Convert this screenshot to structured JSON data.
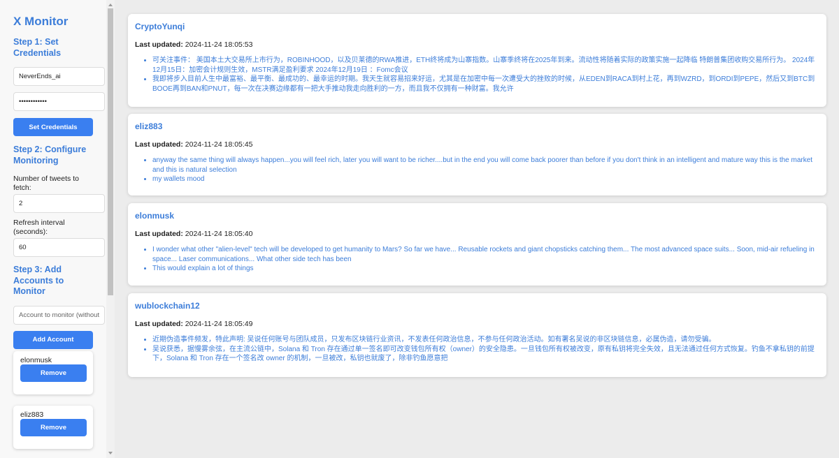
{
  "sidebar": {
    "app_title": "X Monitor",
    "step1_title": "Step 1: Set Credentials",
    "username_value": "NeverEnds_ai",
    "password_value": "••••••••••••",
    "set_credentials_label": "Set Credentials",
    "step2_title": "Step 2: Configure Monitoring",
    "tweets_label": "Number of tweets to fetch:",
    "tweets_value": "2",
    "interval_label": "Refresh interval (seconds):",
    "interval_value": "60",
    "step3_title": "Step 3: Add Accounts to Monitor",
    "account_placeholder": "Account to monitor (without @)",
    "add_account_label": "Add Account",
    "accounts": [
      {
        "name": "elonmusk",
        "remove_label": "Remove"
      },
      {
        "name": "eliz883",
        "remove_label": "Remove"
      }
    ]
  },
  "feed": [
    {
      "username": "CryptoYunqi",
      "updated_label": "Last updated:",
      "updated_time": "2024-11-24 18:05:53",
      "tweets": [
        "可关注事件： 美国本土大交易所上市行为，ROBINHOOD，以及贝莱德的RWA推进，ETH终将成为山寨指数。山寨季终将在2025年到来。流动性将随着实际的政策实施一起降临 特朗普集团收购交易所行为。 2024年12月15日：加密会计规则生效，MSTR满足盈利要求 2024年12月19日 ：Fomc会议",
        "我即将步入目前人生中最富裕、最平衡、最成功的、最幸运的时期。我天生就容易招来好运，尤其是在加密中每一次遭受大的挫败的时候，从EDEN到RACA到村上花，再到WZRD，到ORDI到PEPE，然后又到BTC到BOOE再到BAN和PNUT，每一次在决赛边缘都有一把大手推动我走向胜利的一方，而且我不仅拥有一种财富。我允许"
      ]
    },
    {
      "username": "eliz883",
      "updated_label": "Last updated:",
      "updated_time": "2024-11-24 18:05:45",
      "tweets": [
        "anyway the same thing will always happen...you will feel rich, later you will want to be richer....but in the end you will come back poorer than before if you don't think in an intelligent and mature way this is the market and this is natural selection",
        "my wallets mood"
      ]
    },
    {
      "username": "elonmusk",
      "updated_label": "Last updated:",
      "updated_time": "2024-11-24 18:05:40",
      "tweets": [
        "I wonder what other \"alien-level\" tech will be developed to get humanity to Mars? So far we have... Reusable rockets and giant chopsticks catching them... The most advanced space suits... Soon, mid-air refueling in space... Laser communications... What other side tech has been",
        "This would explain a lot of things"
      ]
    },
    {
      "username": "wublockchain12",
      "updated_label": "Last updated:",
      "updated_time": "2024-11-24 18:05:49",
      "tweets": [
        "近期伪造事件频发，特此声明: 吴说任何账号与团队成员，只发布区块链行业资讯，不发表任何政治信息，不参与任何政治活动。如有署名吴说的非区块链信息，必属伪造，请勿受骗。",
        "吴说获悉，据慢雾余弦，在主流公链中，Solana 和 Tron 存在通过单一签名即可改变钱包所有权（owner）的安全隐患。一旦钱包所有权被改变，原有私钥将完全失效，且无法通过任何方式恢复。钓鱼不拿私钥的前提下，Solana 和 Tron 存在一个签名改 owner 的机制，一旦被改，私钥也就废了，除非钓鱼愿意把"
      ]
    }
  ]
}
